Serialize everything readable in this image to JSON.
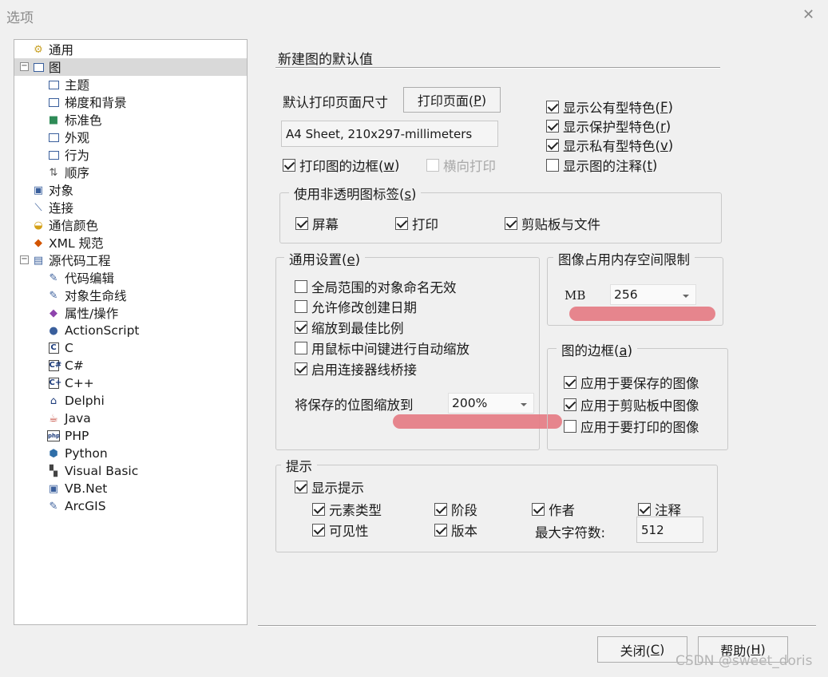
{
  "window": {
    "title": "选项",
    "close_glyph": "✕"
  },
  "tree": {
    "items": [
      {
        "label": "通用",
        "icon": "general-icon"
      },
      {
        "label": "图",
        "icon": "diagram-icon",
        "expander": "−",
        "selected": true
      },
      {
        "label": "主题",
        "icon": "page-icon"
      },
      {
        "label": "梯度和背景",
        "icon": "page-icon"
      },
      {
        "label": "标准色",
        "icon": "palette-icon"
      },
      {
        "label": "外观",
        "icon": "page-icon"
      },
      {
        "label": "行为",
        "icon": "page-icon"
      },
      {
        "label": "顺序",
        "icon": "order-icon"
      },
      {
        "label": "对象",
        "icon": "object-icon"
      },
      {
        "label": "连接",
        "icon": "connector-icon"
      },
      {
        "label": "通信颜色",
        "icon": "color-icon"
      },
      {
        "label": "XML 规范",
        "icon": "xml-icon"
      },
      {
        "label": "源代码工程",
        "icon": "source-icon",
        "expander": "−"
      },
      {
        "label": "代码编辑",
        "icon": "edit-icon"
      },
      {
        "label": "对象生命线",
        "icon": "edit-icon"
      },
      {
        "label": "属性/操作",
        "icon": "attribute-icon"
      },
      {
        "label": "ActionScript",
        "icon": "actionscript-icon"
      },
      {
        "label": "C",
        "icon": "c-icon",
        "badge": "C"
      },
      {
        "label": "C#",
        "icon": "csharp-icon",
        "badge": "C#"
      },
      {
        "label": "C++",
        "icon": "cpp-icon",
        "badge": "C+"
      },
      {
        "label": "Delphi",
        "icon": "delphi-icon"
      },
      {
        "label": "Java",
        "icon": "java-icon"
      },
      {
        "label": "PHP",
        "icon": "php-icon",
        "badge": "php"
      },
      {
        "label": "Python",
        "icon": "python-icon"
      },
      {
        "label": "Visual Basic",
        "icon": "vb-icon"
      },
      {
        "label": "VB.Net",
        "icon": "vbnet-icon"
      },
      {
        "label": "ArcGIS",
        "icon": "arcgis-icon"
      }
    ]
  },
  "section": {
    "title": "新建图的默认值"
  },
  "print": {
    "page_size_label": "默认打印页面尺寸",
    "page_button_text": "打印页面(",
    "page_button_key": "P",
    "page_button_close": ")",
    "page_size_value": "A4 Sheet, 210x297-millimeters",
    "border_label": "打印图的边框(",
    "border_key": "w",
    "border_close": ")",
    "border_checked": true,
    "landscape_label": "横向打印",
    "landscape_checked": false
  },
  "features": [
    {
      "label": "显示公有型特色(",
      "key": "F",
      "close": ")",
      "checked": true
    },
    {
      "label": "显示保护型特色(",
      "key": "r",
      "close": ")",
      "checked": true
    },
    {
      "label": "显示私有型特色(",
      "key": "v",
      "close": ")",
      "checked": true
    },
    {
      "label": "显示图的注释(",
      "key": "t",
      "close": ")",
      "checked": false
    }
  ],
  "opaque": {
    "title": "使用非透明图标签(",
    "key": "s",
    "close": ")",
    "items": [
      {
        "label": "屏幕",
        "checked": true
      },
      {
        "label": "打印",
        "checked": true
      },
      {
        "label": "剪贴板与文件",
        "checked": true
      }
    ]
  },
  "general": {
    "title": "通用设置(",
    "key": "e",
    "close": ")",
    "items": [
      {
        "label": "全局范围的对象命名无效",
        "checked": false
      },
      {
        "label": "允许修改创建日期",
        "checked": false
      },
      {
        "label": "缩放到最佳比例",
        "checked": true
      },
      {
        "label": "用鼠标中间键进行自动缩放",
        "checked": false
      },
      {
        "label": "启用连接器线桥接",
        "checked": true
      }
    ],
    "scale_label": "将保存的位图缩放到",
    "scale_value": "200%"
  },
  "memory": {
    "title": "图像占用内存空间限制",
    "unit": "MB",
    "value": "256"
  },
  "border": {
    "title": "图的边框(",
    "key": "a",
    "close": ")",
    "items": [
      {
        "label": "应用于要保存的图像",
        "checked": true
      },
      {
        "label": "应用于剪贴板中图像",
        "checked": true
      },
      {
        "label": "应用于要打印的图像",
        "checked": false
      }
    ]
  },
  "hints": {
    "title": "提示",
    "show_label": "显示提示",
    "show_checked": true,
    "items": [
      {
        "label": "元素类型",
        "checked": true
      },
      {
        "label": "阶段",
        "checked": true
      },
      {
        "label": "作者",
        "checked": true
      },
      {
        "label": "注释",
        "checked": true
      },
      {
        "label": "可见性",
        "checked": true
      },
      {
        "label": "版本",
        "checked": true
      }
    ],
    "max_chars_label": "最大字符数:",
    "max_chars_value": "512"
  },
  "buttons": {
    "close_text": "关闭(",
    "close_key": "C",
    "close_end": ")",
    "help_text": "帮助(",
    "help_key": "H",
    "help_end": ")"
  },
  "watermark": "CSDN @sweet_doris",
  "colors": {
    "annotation_stroke": "#e57c84",
    "selection": "#d9d9d9"
  }
}
